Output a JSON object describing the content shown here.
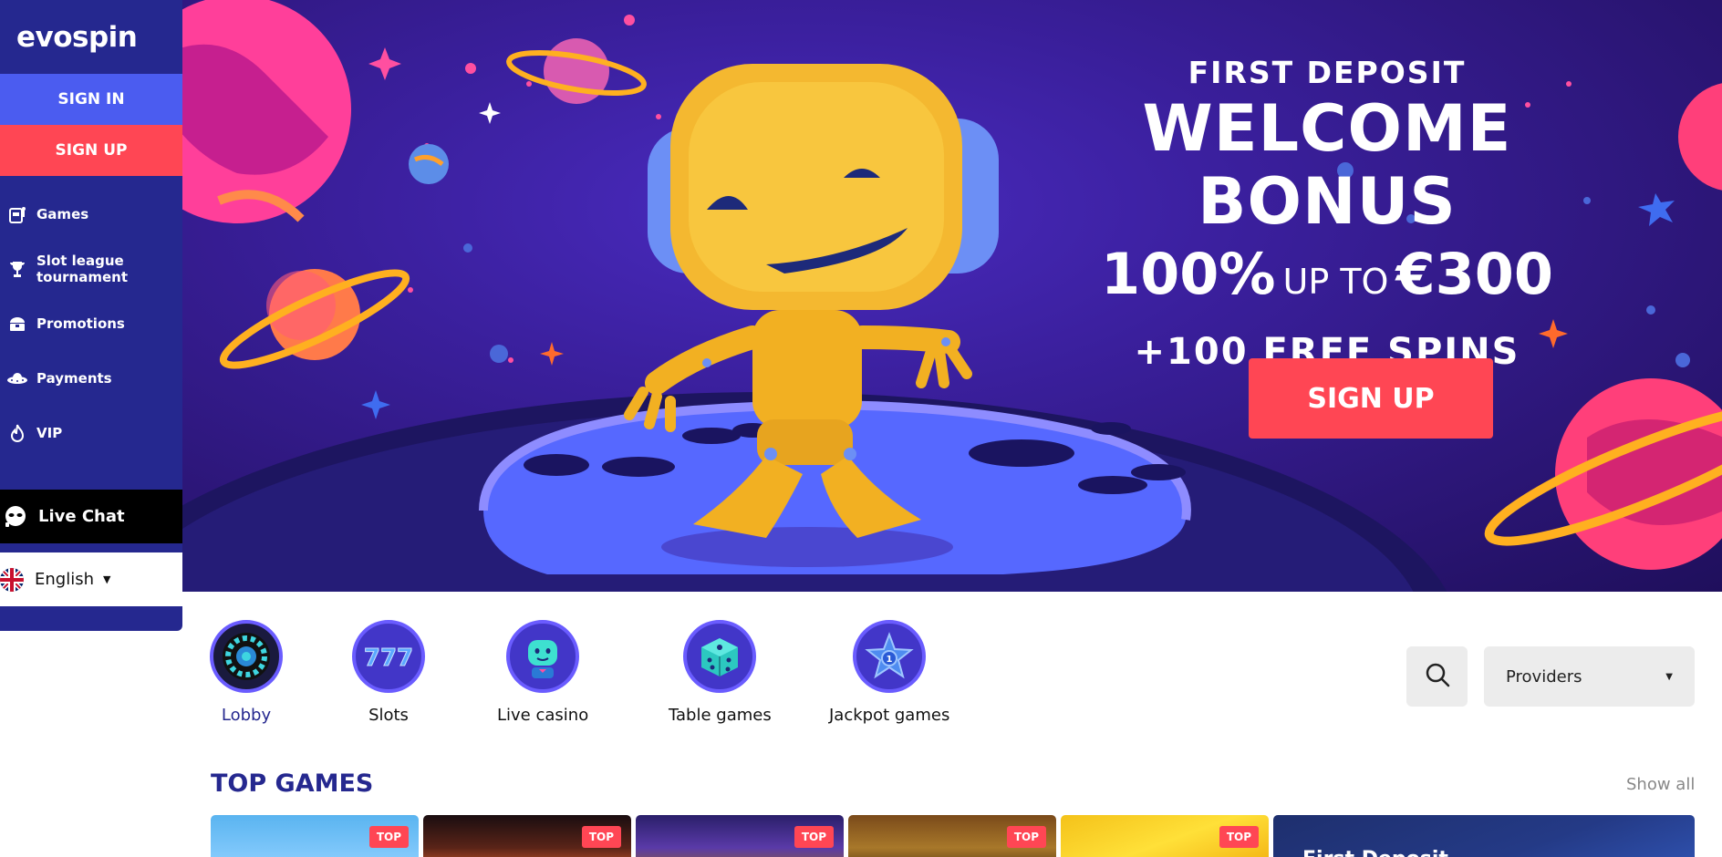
{
  "brand": {
    "logo_text": "evospin"
  },
  "auth": {
    "sign_in": "SIGN IN",
    "sign_up": "SIGN UP"
  },
  "sidebar": {
    "items": [
      {
        "label": "Games",
        "icon": "slot-machine-icon"
      },
      {
        "label": "Slot league tournament",
        "icon": "trophy-icon"
      },
      {
        "label": "Promotions",
        "icon": "treasure-chest-icon"
      },
      {
        "label": "Payments",
        "icon": "ufo-icon"
      },
      {
        "label": "VIP",
        "icon": "fire-icon"
      }
    ],
    "live_chat": "Live Chat",
    "language": "English"
  },
  "hero": {
    "line1": "FIRST DEPOSIT",
    "line2": "WELCOME BONUS",
    "percent": "100%",
    "up_to": "UP TO",
    "amount": "€300",
    "spins": "+100 FREE SPINS",
    "cta": "SIGN UP"
  },
  "categories": [
    {
      "label": "Lobby",
      "icon": "roulette-icon",
      "active": true
    },
    {
      "label": "Slots",
      "icon": "triple-seven-icon"
    },
    {
      "label": "Live casino",
      "icon": "robot-dealer-icon"
    },
    {
      "label": "Table games",
      "icon": "dice-icon"
    },
    {
      "label": "Jackpot games",
      "icon": "star-coin-icon"
    }
  ],
  "filters": {
    "providers": "Providers"
  },
  "top_games": {
    "title": "TOP GAMES",
    "show_all": "Show all",
    "badge": "TOP",
    "promo_text": "First Deposit"
  },
  "colors": {
    "sidebar": "#25288f",
    "sign_in": "#4b5cf0",
    "accent_red": "#ff4654",
    "title_blue": "#25288f"
  }
}
